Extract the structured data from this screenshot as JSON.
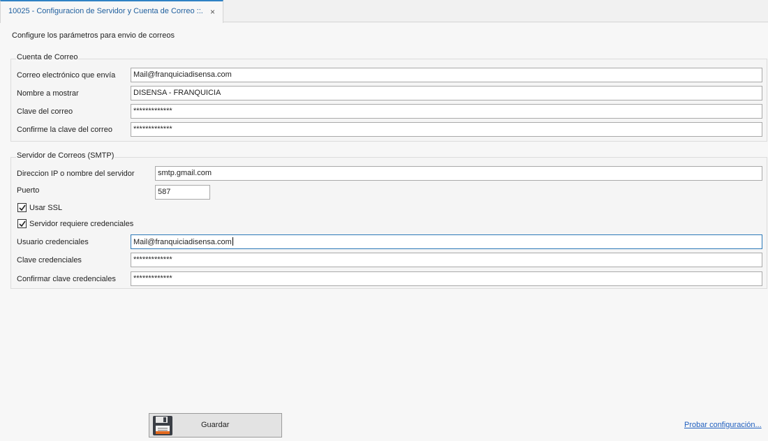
{
  "tab": {
    "title": "10025 - Configuracion de Servidor y Cuenta de Correo ::.",
    "close": "×"
  },
  "intro": "Configure los parámetros para envio de correos",
  "account": {
    "title": "Cuenta de Correo",
    "email_label": "Correo electrónico que envía",
    "email_value": "Mail@franquiciadisensa.com",
    "display_label": "Nombre a mostrar",
    "display_value": "DISENSA - FRANQUICIA",
    "password_label": "Clave del correo",
    "password_value": "*************",
    "confirm_label": "Confirme la clave del correo",
    "confirm_value": "*************"
  },
  "smtp": {
    "title": "Servidor de Correos (SMTP)",
    "server_label": "Direccion IP o nombre del servidor",
    "server_value": "smtp.gmail.com",
    "port_label": "Puerto",
    "port_value": "587",
    "ssl_label": "Usar SSL",
    "ssl_checked": true,
    "cred_label": "Servidor requiere credenciales",
    "cred_checked": true,
    "user_label": "Usuario credenciales",
    "user_value": "Mail@franquiciadisensa.com",
    "cred_password_label": "Clave credenciales",
    "cred_password_value": "*************",
    "cred_confirm_label": "Confirmar clave credenciales",
    "cred_confirm_value": "*************"
  },
  "actions": {
    "save_label": "Guardar",
    "save_icon": "floppy-disk-icon",
    "test_label": "Probar configuración..."
  }
}
